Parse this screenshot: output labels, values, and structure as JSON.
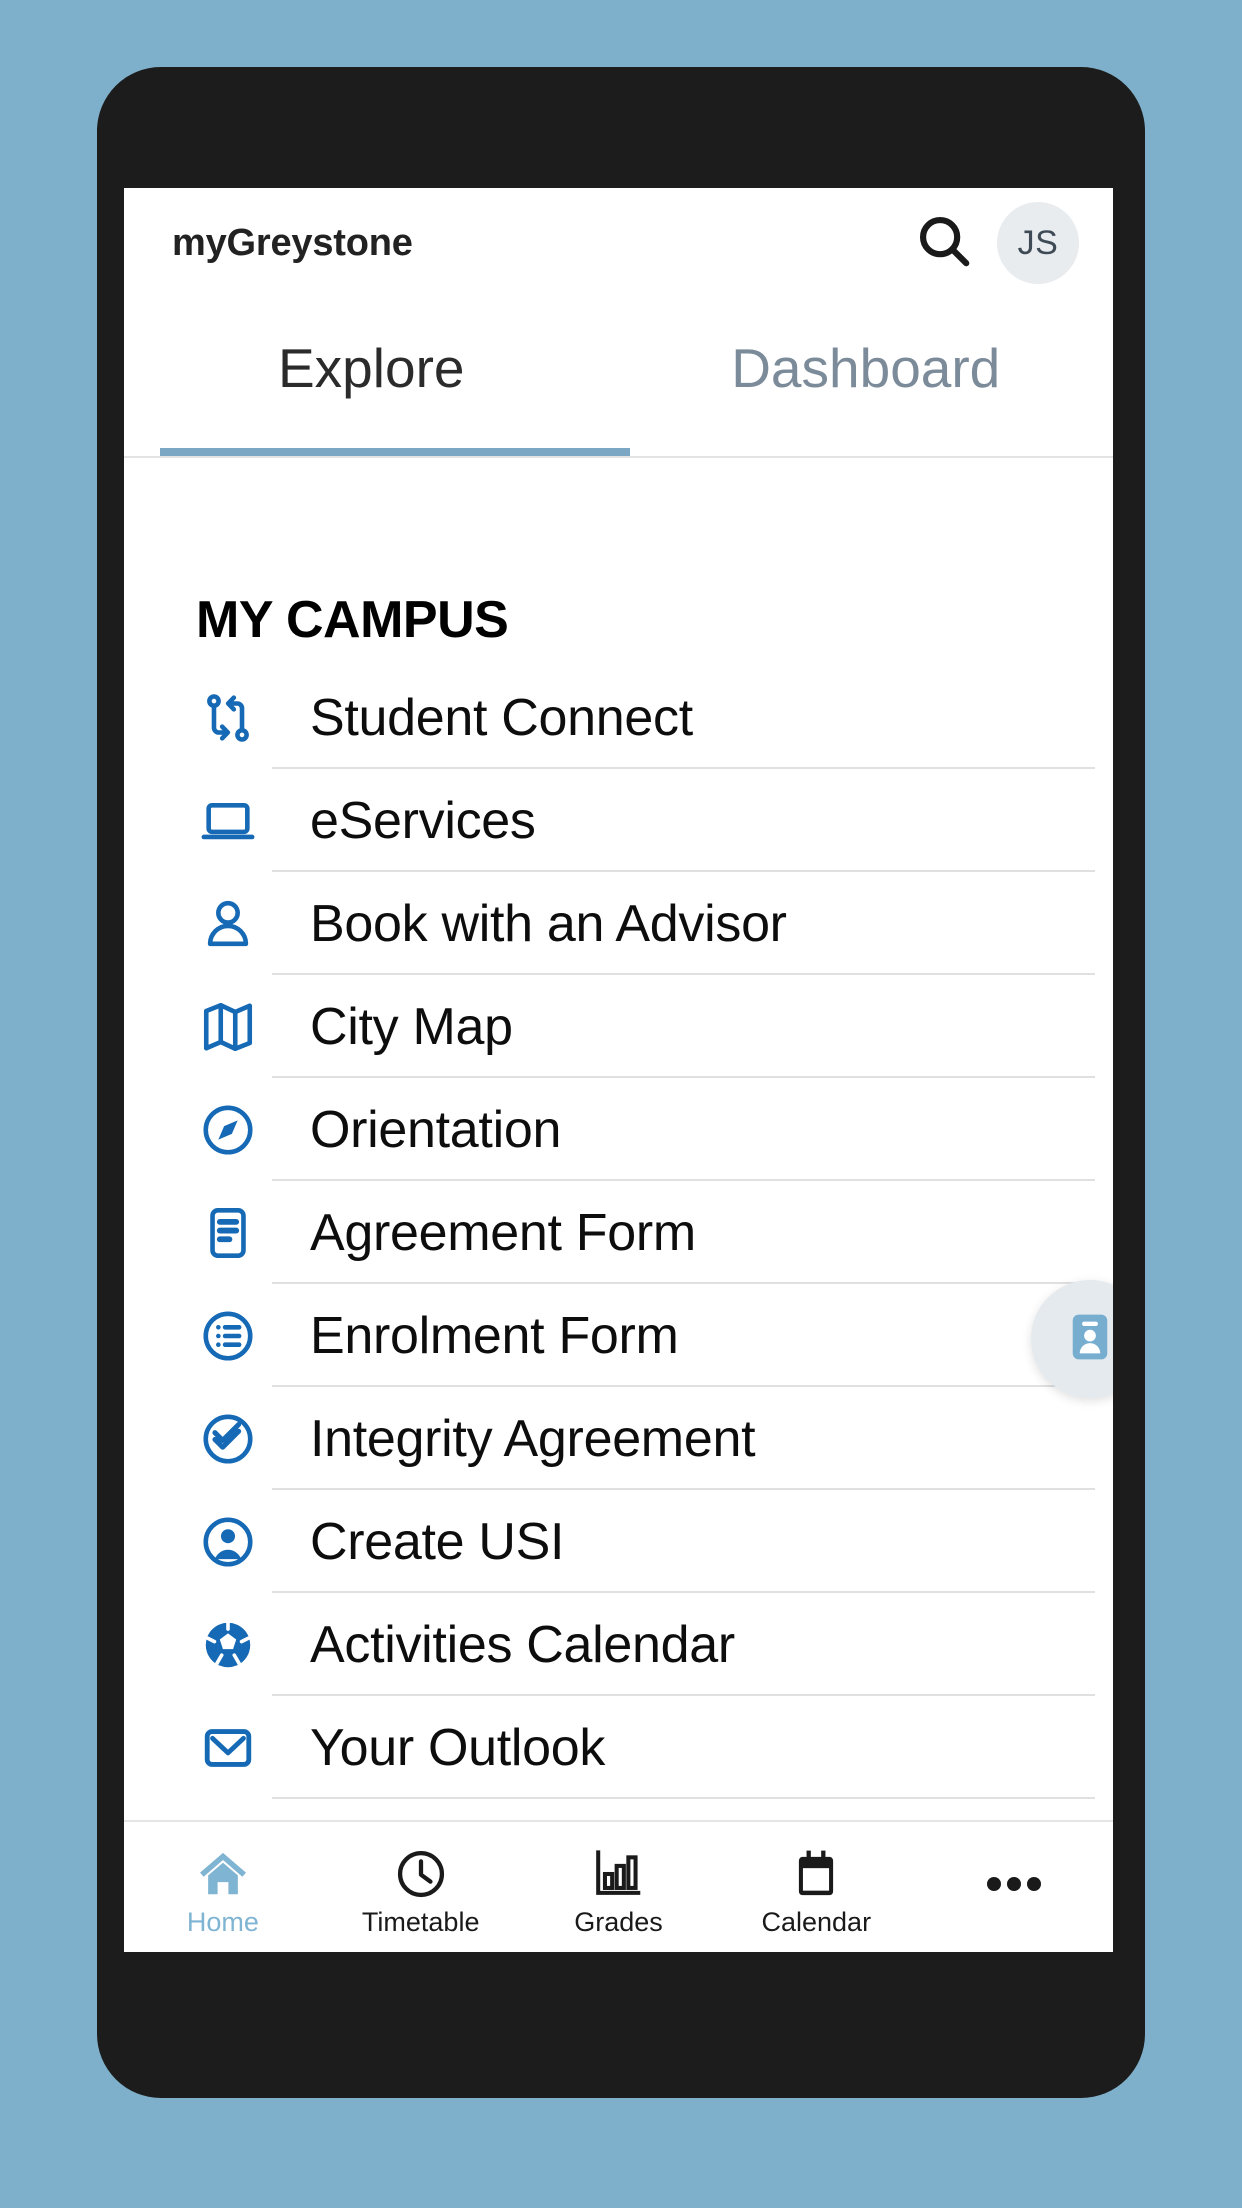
{
  "theme": {
    "background": "#7fb0cb",
    "frame": "#1c1c1c",
    "screen": "#ffffff",
    "accent": "#7ba7c4",
    "icon_blue": "#1569b5",
    "nav_active": "#7fb4d2"
  },
  "app_bar": {
    "title": "myGreystone",
    "search_icon": "search-icon",
    "avatar_initials": "JS"
  },
  "tabs": [
    {
      "label": "Explore",
      "active": true
    },
    {
      "label": "Dashboard",
      "active": false
    }
  ],
  "section": {
    "title": "MY CAMPUS"
  },
  "list_items": [
    {
      "label": "Student Connect",
      "icon": "branch-connect-icon"
    },
    {
      "label": "eServices",
      "icon": "laptop-icon"
    },
    {
      "label": "Book with an Advisor",
      "icon": "person-icon"
    },
    {
      "label": "City Map",
      "icon": "map-icon"
    },
    {
      "label": "Orientation",
      "icon": "compass-icon"
    },
    {
      "label": "Agreement Form",
      "icon": "document-icon"
    },
    {
      "label": "Enrolment Form",
      "icon": "list-circle-icon"
    },
    {
      "label": "Integrity Agreement",
      "icon": "double-check-circle-icon"
    },
    {
      "label": "Create USI",
      "icon": "account-circle-icon"
    },
    {
      "label": "Activities Calendar",
      "icon": "ball-icon"
    },
    {
      "label": "Your Outlook",
      "icon": "mail-icon"
    }
  ],
  "fab": {
    "icon": "id-badge-icon"
  },
  "bottom_nav": [
    {
      "label": "Home",
      "icon": "home-icon",
      "active": true
    },
    {
      "label": "Timetable",
      "icon": "clock-icon",
      "active": false
    },
    {
      "label": "Grades",
      "icon": "bar-chart-icon",
      "active": false
    },
    {
      "label": "Calendar",
      "icon": "calendar-icon",
      "active": false
    },
    {
      "label": "",
      "icon": "more-dots-icon",
      "active": false
    }
  ]
}
